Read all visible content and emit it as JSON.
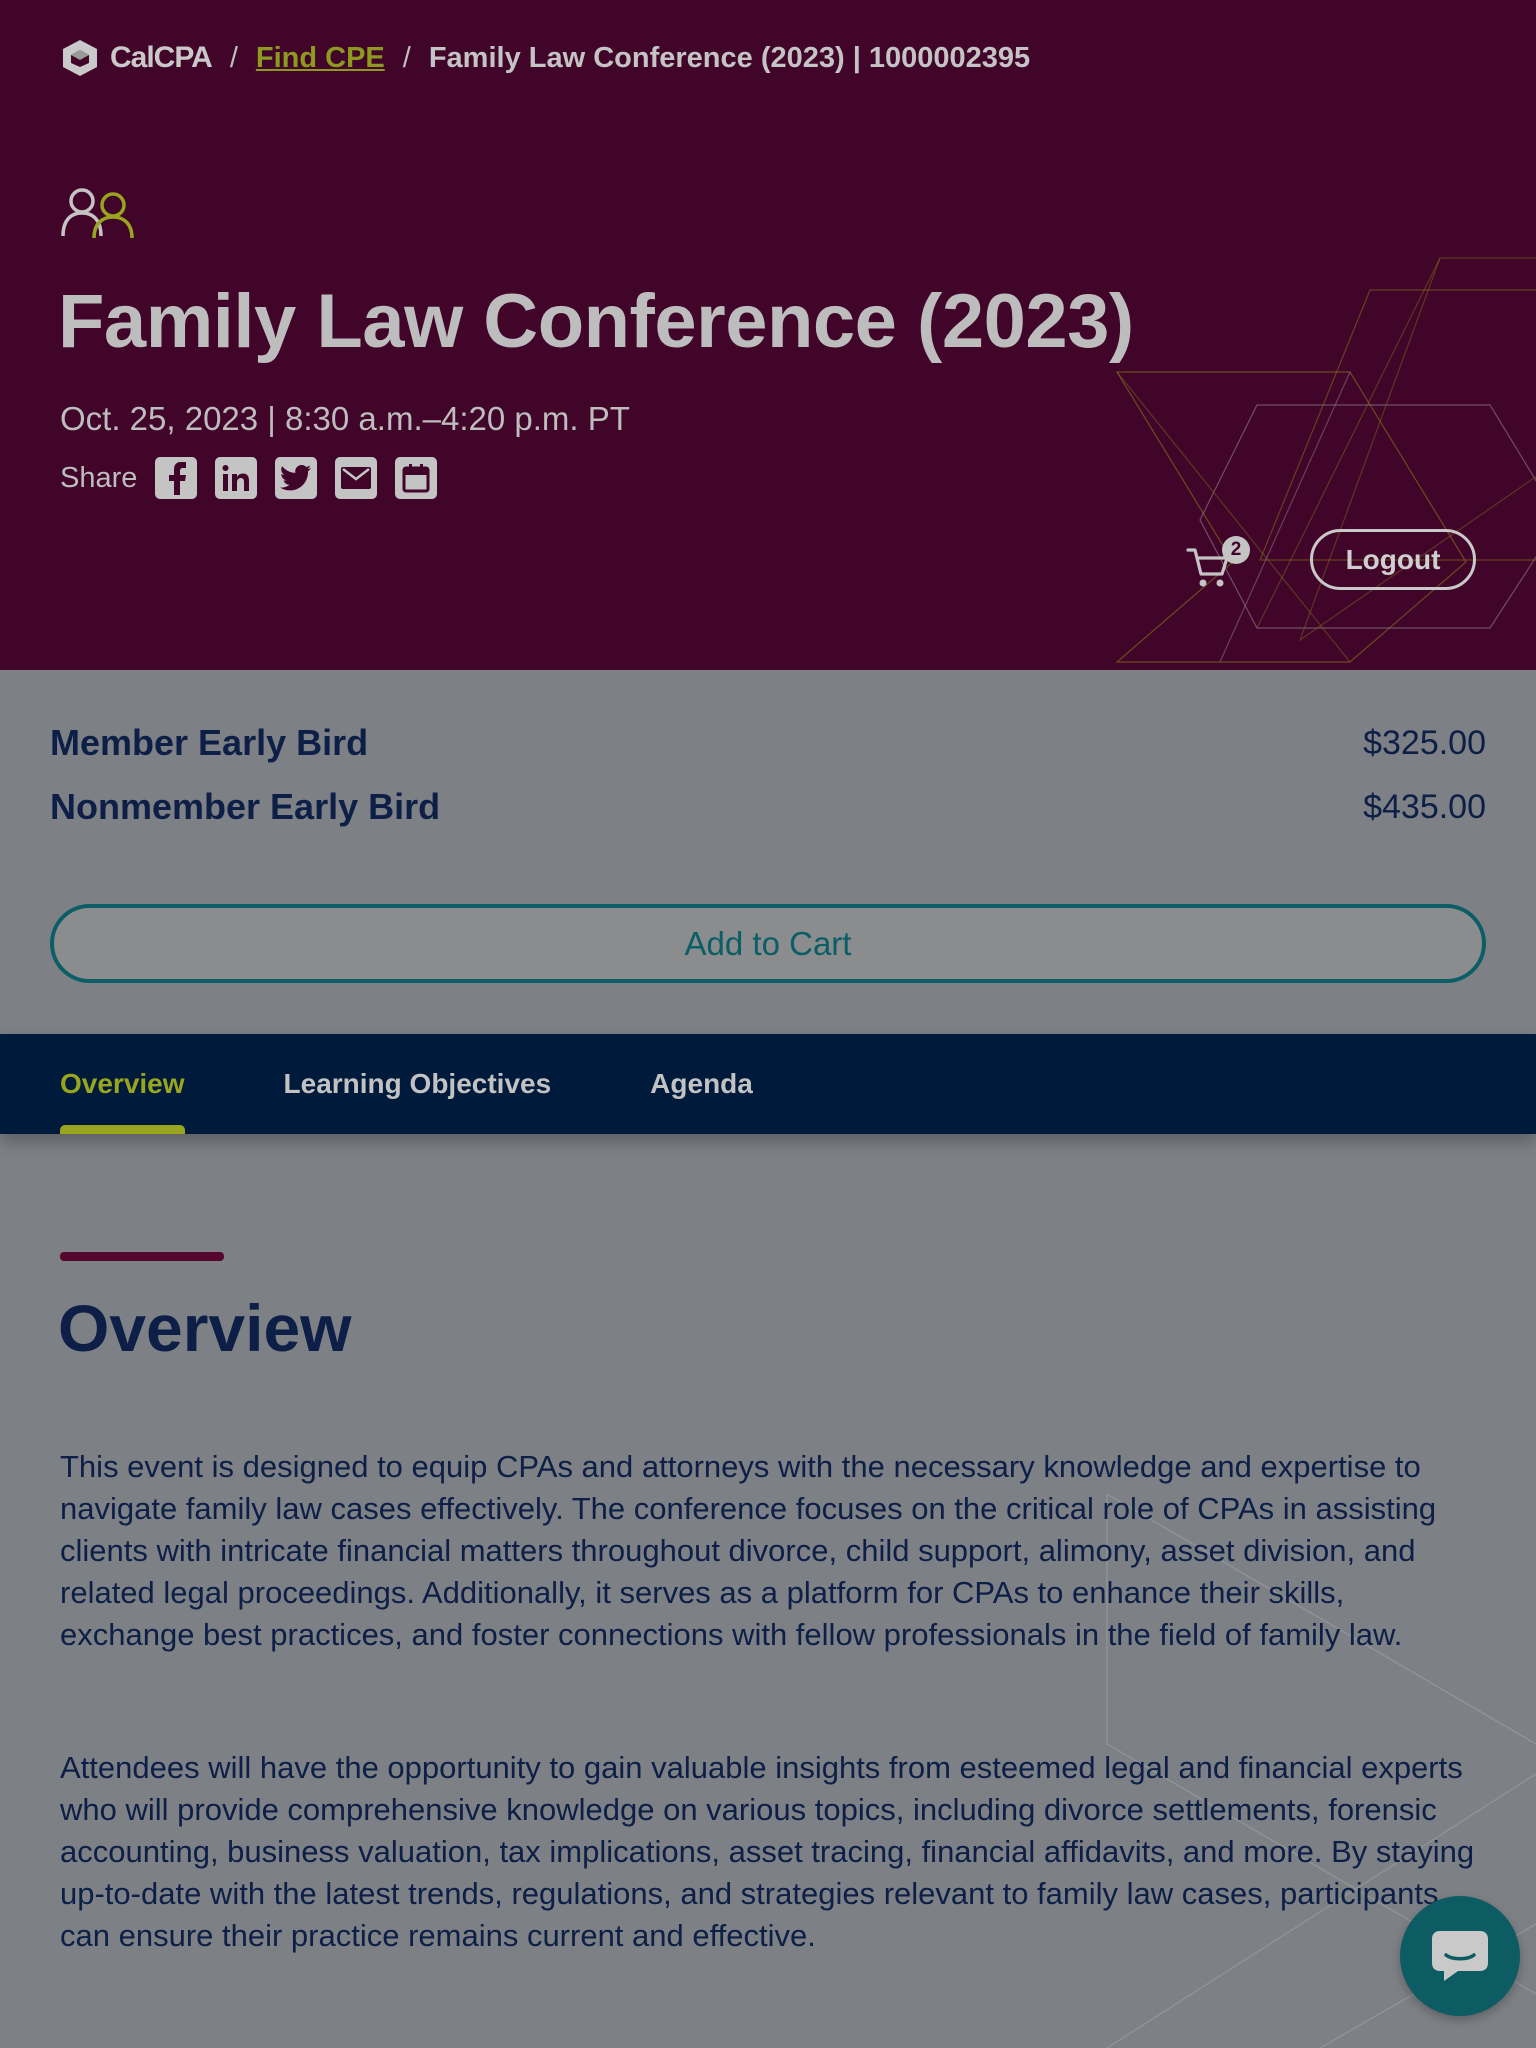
{
  "breadcrumb": {
    "logo_text": "CalCPA",
    "separator": "/",
    "find_cpe": "Find CPE",
    "current": "Family Law Conference (2023) | 1000002395"
  },
  "event": {
    "title": "Family Law Conference (2023)",
    "date_time": "Oct. 25, 2023 | 8:30 a.m.–4:20 p.m. PT",
    "share_label": "Share",
    "share_icons": [
      "facebook-icon",
      "linkedin-icon",
      "twitter-icon",
      "email-icon",
      "calendar-icon"
    ]
  },
  "header_actions": {
    "cart_count": "2",
    "logout_label": "Logout"
  },
  "pricing": [
    {
      "name": "Member Early Bird",
      "price": "$325.00"
    },
    {
      "name": "Nonmember Early Bird",
      "price": "$435.00"
    }
  ],
  "add_to_cart_label": "Add to Cart",
  "tabs": [
    {
      "label": "Overview",
      "active": true
    },
    {
      "label": "Learning Objectives",
      "active": false
    },
    {
      "label": "Agenda",
      "active": false
    }
  ],
  "overview": {
    "heading": "Overview",
    "paragraphs": [
      "This event is designed to equip CPAs and attorneys with the necessary knowledge and expertise to navigate family law cases effectively. The conference focuses on the critical role of CPAs in assisting clients with intricate financial matters throughout divorce, child support, alimony, asset division, and related legal proceedings. Additionally, it serves as a platform for CPAs to enhance their skills, exchange best practices, and foster connections with fellow professionals in the field of family law.",
      "Attendees will have the opportunity to gain valuable insights from esteemed legal and financial experts who will provide comprehensive knowledge on various topics, including divorce settlements, forensic accounting, business valuation, tax implications, asset tracing, financial affidavits, and more. By staying up-to-date with the latest trends, regulations, and strategies relevant to family law cases, participants can ensure their practice remains current and effective."
    ]
  },
  "colors": {
    "hero_bg": "#42052a",
    "accent_green": "#98a51f",
    "navy": "#001a3c",
    "teal": "#0b5e66",
    "text_dark": "#0d1f47"
  }
}
